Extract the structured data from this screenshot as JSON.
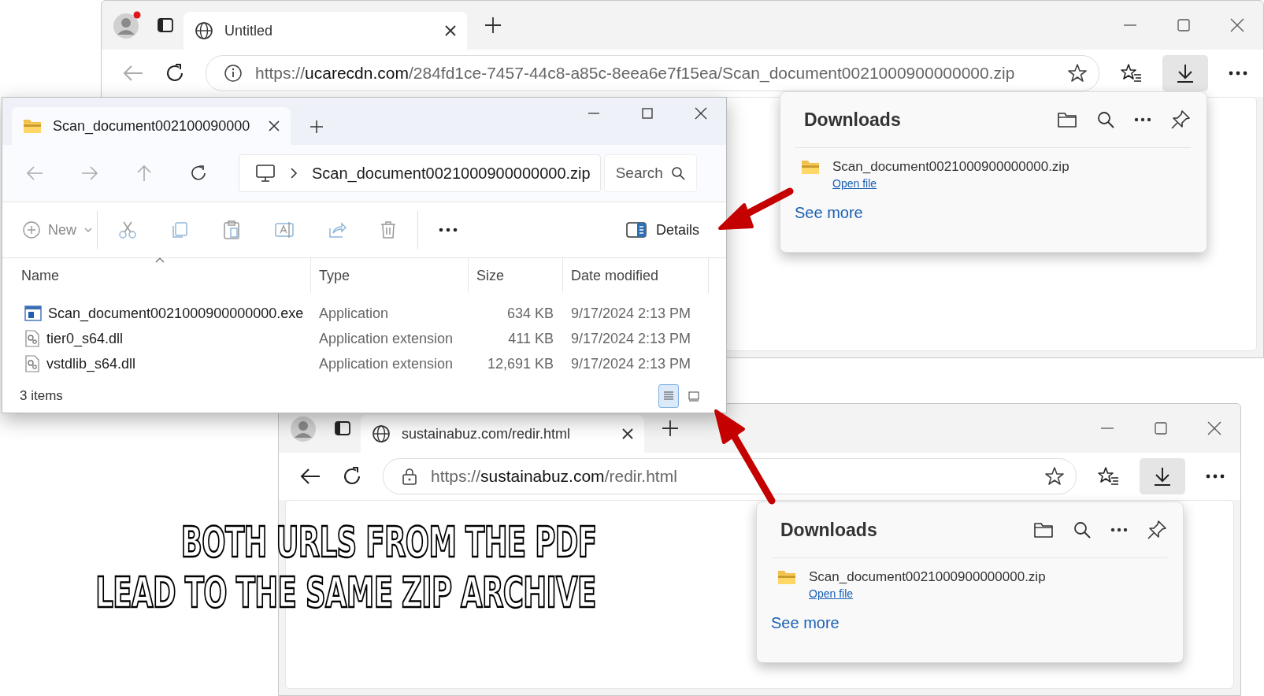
{
  "browsers": [
    {
      "notification": true,
      "tab_title": "Untitled",
      "site_icon": {
        "kind": "info"
      },
      "url_scheme": "https://",
      "url_host": "ucarecdn.com",
      "url_path": "/284fd1ce-7457-44c8-a85c-8eea6e7f15ea/Scan_document0021000900000000.zip",
      "downloads": {
        "title": "Downloads",
        "file": "Scan_document0021000900000000.zip",
        "link": "Open file",
        "more": "See more"
      }
    },
    {
      "notification": false,
      "tab_title": "sustainabuz.com/redir.html",
      "site_icon": {
        "kind": "lock"
      },
      "url_scheme": "https://",
      "url_host": "sustainabuz.com",
      "url_path": "/redir.html",
      "downloads": {
        "title": "Downloads",
        "file": "Scan_document0021000900000000.zip",
        "link": "Open file",
        "more": "See more"
      }
    }
  ],
  "explorer": {
    "tab_title": "Scan_document002100090000",
    "address": "Scan_document0021000900000000.zip",
    "search": {
      "placeholder": "Search"
    },
    "new_label": "New",
    "details_label": "Details",
    "columns": [
      "Name",
      "Type",
      "Size",
      "Date modified"
    ],
    "rows": [
      {
        "kind": "exe",
        "name": "Scan_document0021000900000000.exe",
        "type": "Application",
        "size": "634 KB",
        "date": "9/17/2024 2:13 PM"
      },
      {
        "kind": "dll",
        "name": "tier0_s64.dll",
        "type": "Application extension",
        "size": "411 KB",
        "date": "9/17/2024 2:13 PM"
      },
      {
        "kind": "dll",
        "name": "vstdlib_s64.dll",
        "type": "Application extension",
        "size": "12,691 KB",
        "date": "9/17/2024 2:13 PM"
      }
    ],
    "status": "3 items",
    "view_buttons": [
      {
        "kind": "details",
        "selected": true
      },
      {
        "kind": "tiles",
        "selected": false
      }
    ]
  },
  "caption": [
    "BOTH URLS FROM THE PDF",
    "LEAD TO THE SAME ZIP ARCHIVE"
  ]
}
